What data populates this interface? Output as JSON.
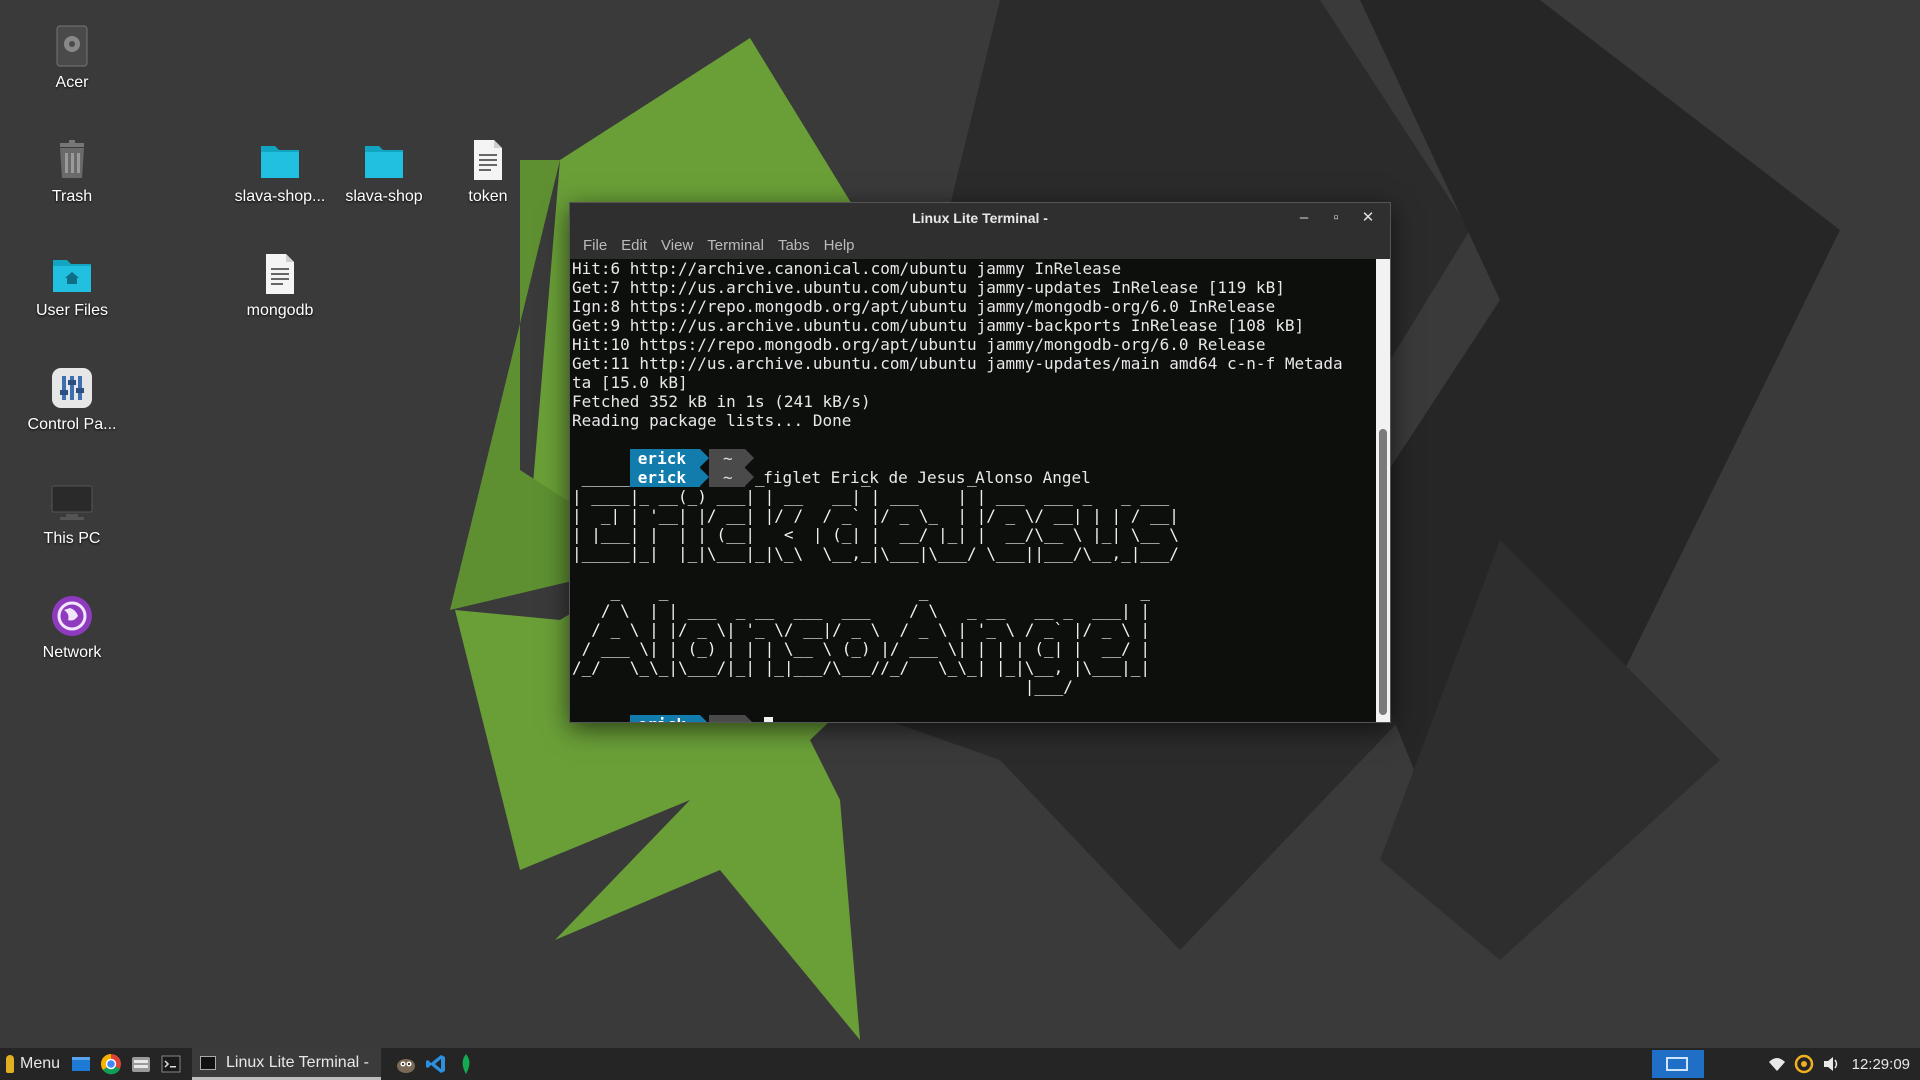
{
  "desktop": {
    "icons_left": [
      {
        "name": "drive-icon",
        "label": "Acer"
      },
      {
        "name": "trash-icon",
        "label": "Trash"
      },
      {
        "name": "home-folder-icon",
        "label": "User Files"
      },
      {
        "name": "control-panel-icon",
        "label": "Control Pa..."
      },
      {
        "name": "computer-icon",
        "label": "This PC"
      },
      {
        "name": "network-icon",
        "label": "Network"
      }
    ],
    "icons_files": [
      {
        "name": "folder-icon",
        "label": "slava-shop..."
      },
      {
        "name": "folder-icon",
        "label": "slava-shop"
      },
      {
        "name": "text-file-icon",
        "label": "token"
      },
      {
        "name": "text-file-icon",
        "label": "mongodb"
      }
    ]
  },
  "terminal": {
    "title": "Linux Lite Terminal -",
    "menu": [
      "File",
      "Edit",
      "View",
      "Terminal",
      "Tabs",
      "Help"
    ],
    "output_lines": [
      "Hit:6 http://archive.canonical.com/ubuntu jammy InRelease",
      "Get:7 http://us.archive.ubuntu.com/ubuntu jammy-updates InRelease [119 kB]",
      "Ign:8 https://repo.mongodb.org/apt/ubuntu jammy/mongodb-org/6.0 InRelease",
      "Get:9 http://us.archive.ubuntu.com/ubuntu jammy-backports InRelease [108 kB]",
      "Hit:10 https://repo.mongodb.org/apt/ubuntu jammy/mongodb-org/6.0 Release",
      "Get:11 http://us.archive.ubuntu.com/ubuntu jammy-updates/main amd64 c-n-f Metada",
      "ta [15.0 kB]",
      "Fetched 352 kB in 1s (241 kB/s)",
      "Reading package lists... Done"
    ],
    "prompt_user": "erick",
    "prompt_dir": "~",
    "command": "figlet Erick de Jesus Alonso Angel",
    "figlet_text": " _____      _      _          _          _                     \n| ____|_ __(_) ___| | __   __| | ___    | | ___  ___ _   _ ___ \n|  _| | '__| |/ __| |/ /  / _` |/ _ \\_  | |/ _ \\/ __| | | / __|\n| |___| |  | | (__|   <  | (_| |  __/ |_| |  __/\\__ \\ |_| \\__ \\\n|_____|_|  |_|\\___|_|\\_\\  \\__,_|\\___|\\___/ \\___||___/\\__,_|___/\n                                                              \n    _    _                          _                      _ \n   / \\  | | ___  _ __  ___  ___    / \\   _ __   __ _  ___| |\n  / _ \\ | |/ _ \\| '_ \\/ __|/ _ \\  / _ \\ | '_ \\ / _` |/ _ \\ |\n / ___ \\| | (_) | | | \\__ \\ (_) |/ ___ \\| | | | (_| |  __/ |\n/_/   \\_\\_|\\___/|_| |_|___/\\___//_/   \\_\\_| |_|\\__, |\\___|_|\n                                               |___/       "
  },
  "taskbar": {
    "menu_label": "Menu",
    "active_task": "Linux Lite Terminal -",
    "clock": "12:29:09"
  },
  "colors": {
    "wallpaper_bg": "#3a3a3a",
    "leaf_green": "#6a9f38",
    "prompt_user_bg": "#127cad",
    "prompt_dir_bg": "#4a4a4a"
  }
}
